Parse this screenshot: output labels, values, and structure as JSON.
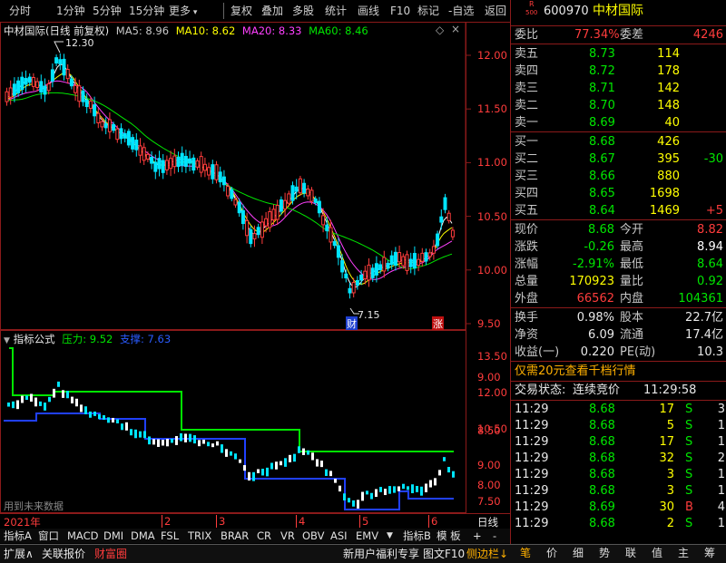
{
  "toolbar": {
    "items": [
      "分时",
      "1分钟",
      "5分钟",
      "15分钟",
      "更多",
      "复权",
      "叠加",
      "多股",
      "统计",
      "画线",
      "F10",
      "标记",
      "-自选",
      "返回"
    ]
  },
  "main_chart": {
    "title": "中材国际(日线 前复权)",
    "ma_labels": [
      {
        "text": "MA5: 8.96",
        "color": "#ffffff"
      },
      {
        "text": "MA10: 8.62",
        "color": "#ffff00"
      },
      {
        "text": "MA20: 8.33",
        "color": "#ff40ff"
      },
      {
        "text": "MA60: 8.46",
        "color": "#00e600"
      }
    ],
    "high_marker": "12.30",
    "low_marker": "7.15",
    "price_ticks": [
      "12.00",
      "11.50",
      "11.00",
      "10.50",
      "10.00",
      "9.50",
      "9.00",
      "8.50",
      "8.00",
      "7.50"
    ],
    "event_cai": "财",
    "event_zhang": "涨"
  },
  "indicator": {
    "name": "指标公式",
    "pressure": "压力: 9.52",
    "support": "支撑: 7.63",
    "ticks": [
      "13.50",
      "12.00",
      "10.50",
      "9.00",
      "7.50"
    ],
    "note": "用到未来数据"
  },
  "time_axis": {
    "year": "2021年",
    "months": [
      "2",
      "3",
      "4",
      "5",
      "6"
    ],
    "period": "日线"
  },
  "tabs": [
    "指标A",
    "窗口",
    "MACD",
    "DMI",
    "DMA",
    "FSL",
    "TRIX",
    "BRAR",
    "CR",
    "VR",
    "OBV",
    "ASI",
    "EMV"
  ],
  "tabs_right": [
    "指标B",
    "模 板",
    "+",
    "-"
  ],
  "statusbar": {
    "left": [
      "扩展∧",
      "关联报价",
      "财富圈"
    ],
    "right": [
      "新用户福利专享",
      "图文F10",
      "侧边栏↓"
    ],
    "buttons": [
      "笔",
      "价",
      "细",
      "势",
      "联",
      "值",
      "主",
      "筹"
    ]
  },
  "quote": {
    "code": "600970",
    "name": "中材国际",
    "badge_top": "R",
    "badge_bottom": "500",
    "weibi_label": "委比",
    "weibi": "77.34%",
    "weicha_label": "委差",
    "weicha": "4246",
    "asks": [
      {
        "label": "卖五",
        "price": "8.73",
        "vol": "114"
      },
      {
        "label": "卖四",
        "price": "8.72",
        "vol": "178"
      },
      {
        "label": "卖三",
        "price": "8.71",
        "vol": "142"
      },
      {
        "label": "卖二",
        "price": "8.70",
        "vol": "148"
      },
      {
        "label": "卖一",
        "price": "8.69",
        "vol": "40"
      }
    ],
    "bids": [
      {
        "label": "买一",
        "price": "8.68",
        "vol": "426",
        "chg": ""
      },
      {
        "label": "买二",
        "price": "8.67",
        "vol": "395",
        "chg": "-30"
      },
      {
        "label": "买三",
        "price": "8.66",
        "vol": "880",
        "chg": ""
      },
      {
        "label": "买四",
        "price": "8.65",
        "vol": "1698",
        "chg": ""
      },
      {
        "label": "买五",
        "price": "8.64",
        "vol": "1469",
        "chg": "+5"
      }
    ],
    "stats": [
      {
        "l1": "现价",
        "v1": "8.68",
        "c1": "#00e600",
        "l2": "今开",
        "v2": "8.82",
        "c2": "#ff3c3c"
      },
      {
        "l1": "涨跌",
        "v1": "-0.26",
        "c1": "#00e600",
        "l2": "最高",
        "v2": "8.94",
        "c2": "#ffffff"
      },
      {
        "l1": "涨幅",
        "v1": "-2.91%",
        "c1": "#00e600",
        "l2": "最低",
        "v2": "8.64",
        "c2": "#00e600"
      },
      {
        "l1": "总量",
        "v1": "170923",
        "c1": "#ffff00",
        "l2": "量比",
        "v2": "0.92",
        "c2": "#00e600"
      },
      {
        "l1": "外盘",
        "v1": "66562",
        "c1": "#ff3c3c",
        "l2": "内盘",
        "v2": "104361",
        "c2": "#00e600"
      }
    ],
    "stats2": [
      {
        "l1": "换手",
        "v1": "0.98%",
        "l2": "股本",
        "v2": "22.7亿"
      },
      {
        "l1": "净资",
        "v1": "6.09",
        "l2": "流通",
        "v2": "17.4亿"
      },
      {
        "l1": "收益(一)",
        "v1": "0.220",
        "l2": "PE(动)",
        "v2": "10.3"
      }
    ],
    "promo": "仅需20元查看千档行情",
    "trade_status_label": "交易状态:",
    "trade_status": "连续竞价",
    "trade_time": "11:29:58",
    "ticks": [
      {
        "t": "11:29",
        "p": "8.68",
        "v": "17",
        "d": "S",
        "n": "3"
      },
      {
        "t": "11:29",
        "p": "8.68",
        "v": "5",
        "d": "S",
        "n": "1"
      },
      {
        "t": "11:29",
        "p": "8.68",
        "v": "17",
        "d": "S",
        "n": "1"
      },
      {
        "t": "11:29",
        "p": "8.68",
        "v": "32",
        "d": "S",
        "n": "2"
      },
      {
        "t": "11:29",
        "p": "8.68",
        "v": "3",
        "d": "S",
        "n": "1"
      },
      {
        "t": "11:29",
        "p": "8.68",
        "v": "3",
        "d": "S",
        "n": "1"
      },
      {
        "t": "11:29",
        "p": "8.69",
        "v": "30",
        "d": "B",
        "n": "4"
      },
      {
        "t": "11:29",
        "p": "8.68",
        "v": "2",
        "d": "S",
        "n": "1"
      }
    ]
  }
}
